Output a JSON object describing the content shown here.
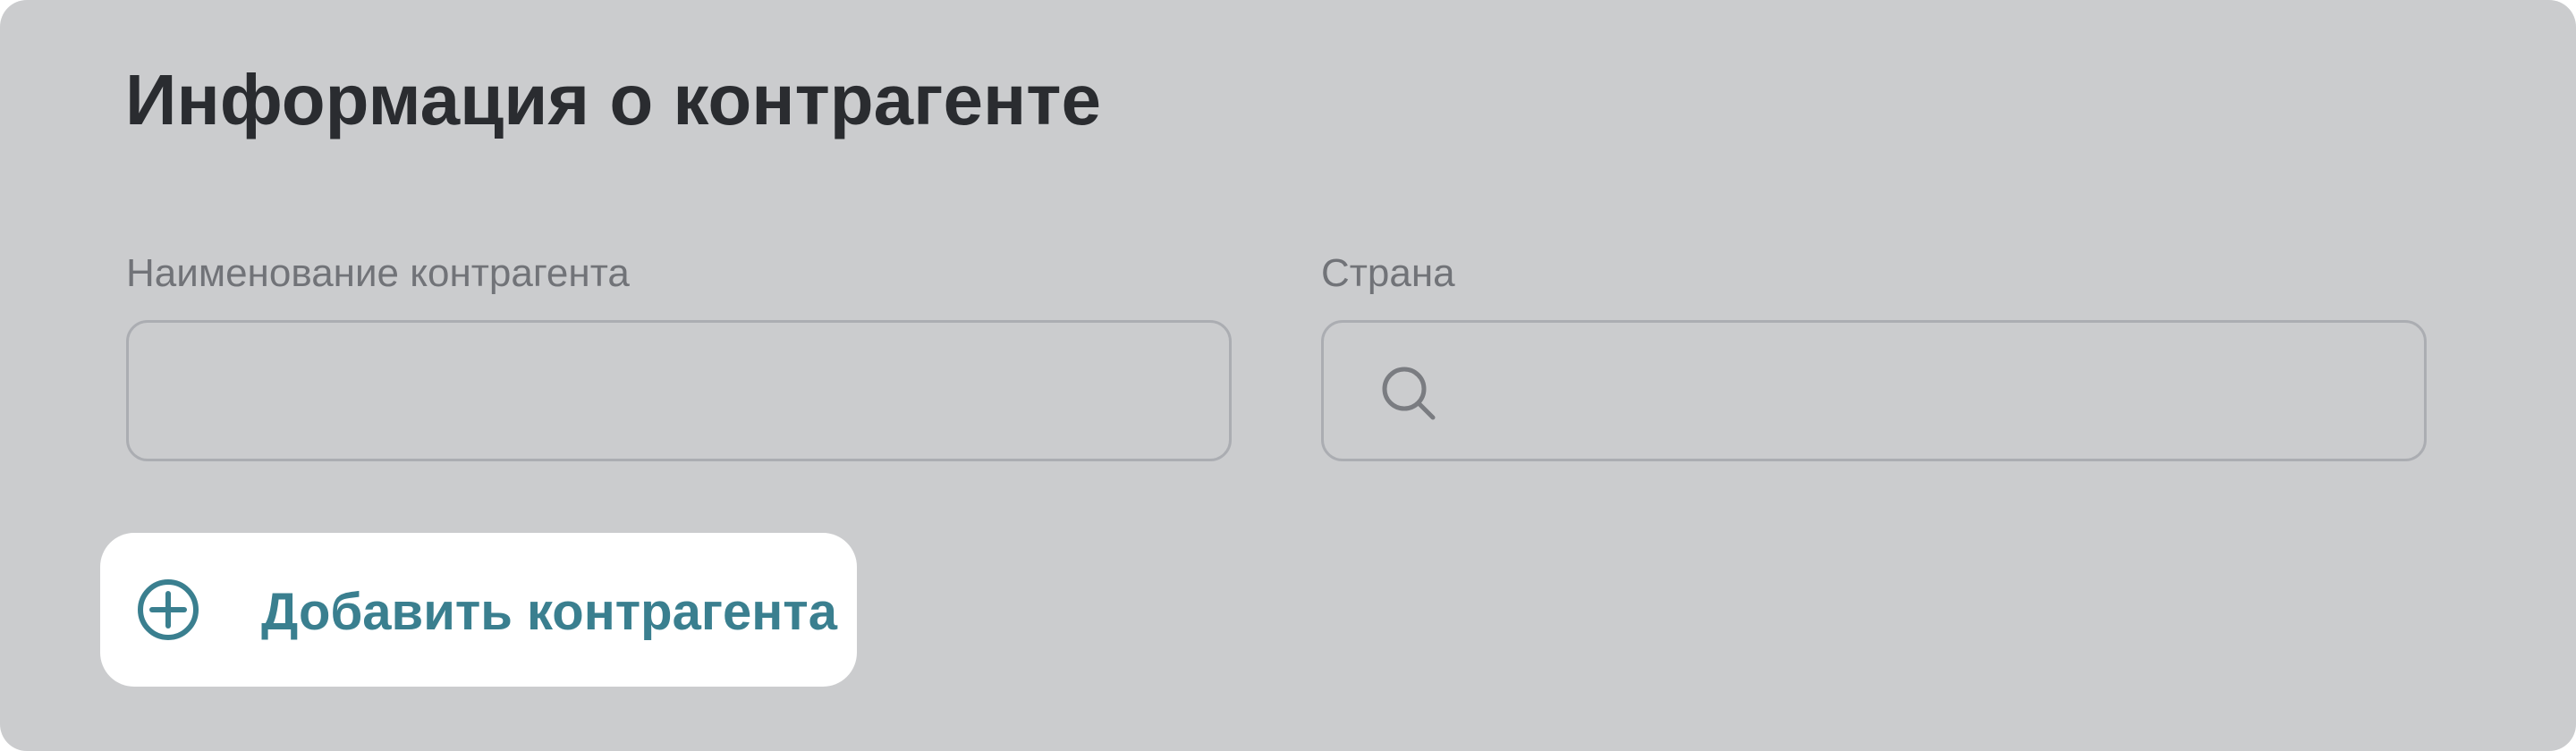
{
  "section": {
    "title": "Информация о контрагенте"
  },
  "form": {
    "counterparty_name": {
      "label": "Наименование контрагента",
      "value": "",
      "placeholder": ""
    },
    "country": {
      "label": "Страна",
      "value": "",
      "placeholder": "",
      "icon": "search-icon"
    }
  },
  "actions": {
    "add_counterparty_label": "Добавить контрагента",
    "add_icon": "plus-circle-icon"
  },
  "colors": {
    "card_background": "#cbccce",
    "title": "#2a2c30",
    "label": "#717378",
    "field_border": "#abadb2",
    "accent": "#3a7f8f",
    "button_background": "#ffffff"
  }
}
